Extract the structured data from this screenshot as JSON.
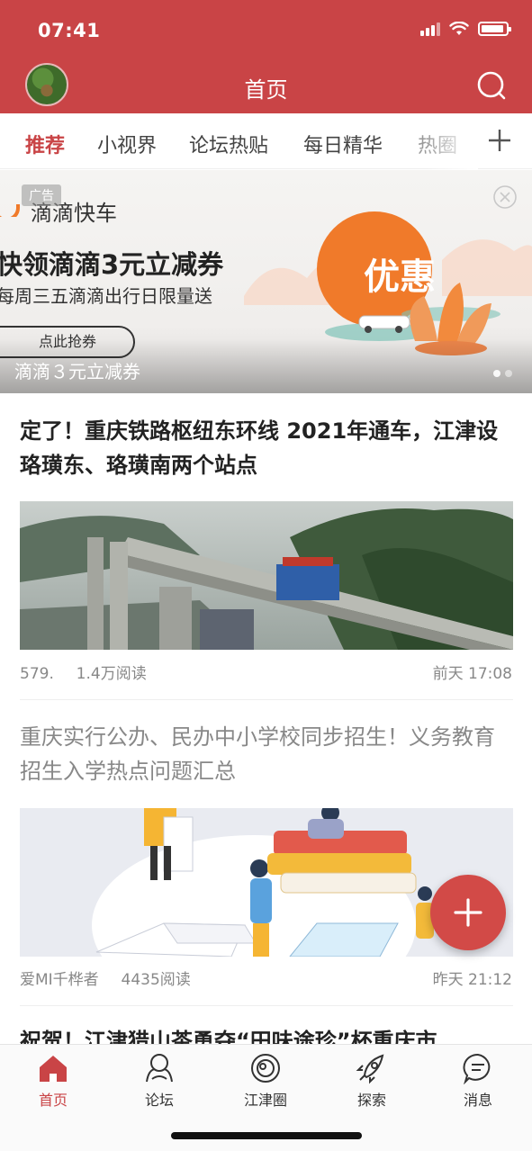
{
  "status_bar": {
    "time": "07:41"
  },
  "header": {
    "title": "首页",
    "search_icon": "search-icon"
  },
  "tabs": [
    {
      "label": "推荐",
      "active": true
    },
    {
      "label": "小视界"
    },
    {
      "label": "论坛热贴"
    },
    {
      "label": "每日精华"
    },
    {
      "label": "热圈"
    }
  ],
  "banner": {
    "ad_label": "广告",
    "brand": "滴滴快车",
    "headline": "快领滴滴3元立减券",
    "subline": "每周三五滴滴出行日限量送",
    "button_label": "点此抢券",
    "promo_text": "优惠",
    "caption": "滴滴３元立减券",
    "colors": {
      "accent": "#f07a2a"
    }
  },
  "articles": [
    {
      "title": "定了！重庆铁路枢纽东环线 2021年通车，江津设珞璜东、珞璜南两个站点",
      "author": "579.",
      "reads": "1.4万阅读",
      "time": "前天 17:08"
    },
    {
      "title": "重庆实行公办、民办中小学校同步招生！义务教育招生入学热点问题汇总",
      "author": "爱MI千桦者",
      "reads": "4435阅读",
      "time": "昨天 21:12"
    },
    {
      "title": "祝贺！江津猎山茶勇夺“田味途珍”杯重庆市"
    }
  ],
  "bottom_nav": [
    {
      "label": "首页",
      "active": true
    },
    {
      "label": "论坛"
    },
    {
      "label": "江津圈"
    },
    {
      "label": "探索"
    },
    {
      "label": "消息"
    }
  ],
  "colors": {
    "brand": "#c94446",
    "fab": "#d24a47"
  }
}
